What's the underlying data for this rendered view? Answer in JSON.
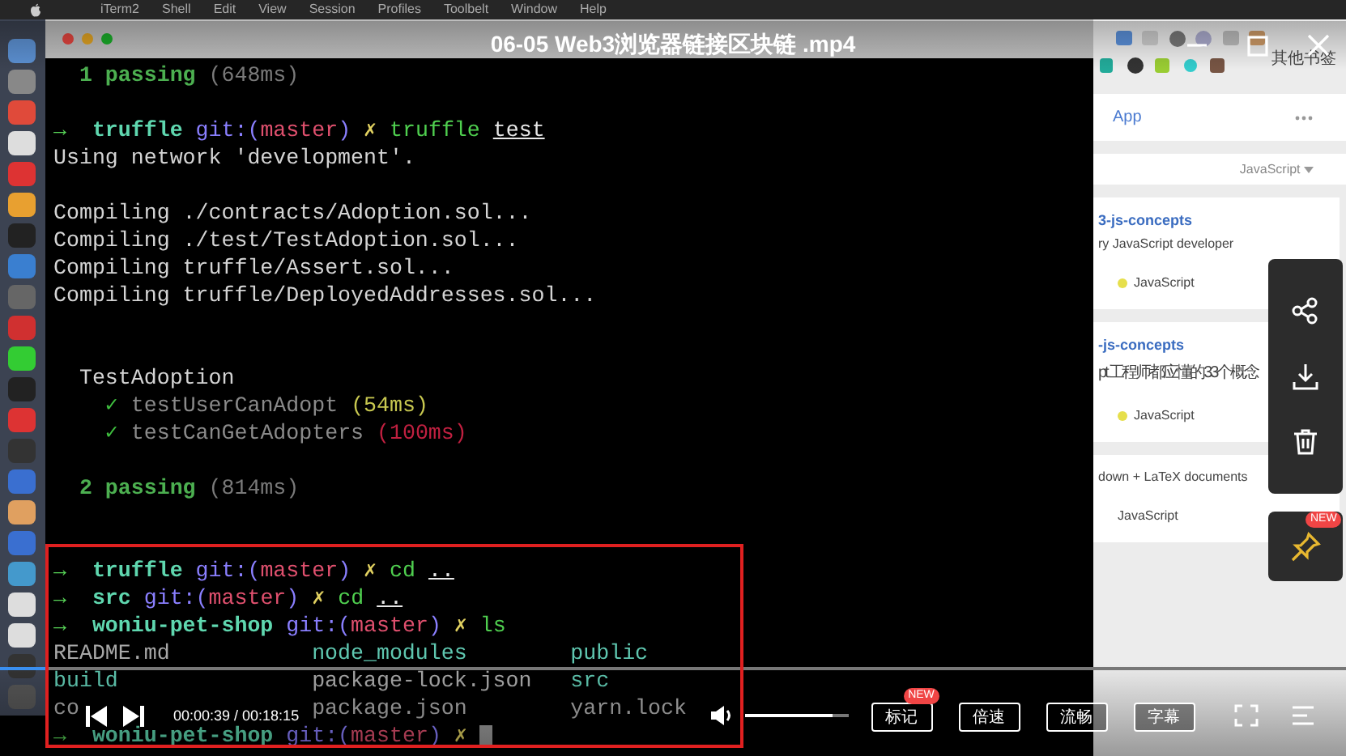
{
  "menubar": {
    "items": [
      "iTerm2",
      "Shell",
      "Edit",
      "View",
      "Session",
      "Profiles",
      "Toolbelt",
      "Window",
      "Help"
    ]
  },
  "terminal": {
    "lines": [
      {
        "kind": "text",
        "segments": [
          {
            "text": "  1 passing",
            "kind": "pass"
          },
          {
            "text": " (648ms)",
            "kind": "dim"
          }
        ]
      },
      {
        "kind": "blank"
      },
      {
        "kind": "text",
        "segments": [
          {
            "text": "→",
            "kind": "arrow"
          },
          {
            "text": "  truffle ",
            "kind": "dir"
          },
          {
            "text": "git:(",
            "kind": "git"
          },
          {
            "text": "master",
            "kind": "branch"
          },
          {
            "text": ")",
            "kind": "git"
          },
          {
            "text": " ✗ ",
            "kind": "dirty"
          },
          {
            "text": "truffle ",
            "kind": "cmd"
          },
          {
            "text": "test",
            "kind": "arg"
          }
        ]
      },
      {
        "kind": "text",
        "segments": [
          {
            "text": "Using network 'development'.",
            "kind": "out"
          }
        ]
      },
      {
        "kind": "blank"
      },
      {
        "kind": "text",
        "segments": [
          {
            "text": "Compiling ./contracts/Adoption.sol...",
            "kind": "out"
          }
        ]
      },
      {
        "kind": "text",
        "segments": [
          {
            "text": "Compiling ./test/TestAdoption.sol...",
            "kind": "out"
          }
        ]
      },
      {
        "kind": "text",
        "segments": [
          {
            "text": "Compiling truffle/Assert.sol...",
            "kind": "out"
          }
        ]
      },
      {
        "kind": "text",
        "segments": [
          {
            "text": "Compiling truffle/DeployedAddresses.sol...",
            "kind": "out"
          }
        ]
      },
      {
        "kind": "blank"
      },
      {
        "kind": "blank"
      },
      {
        "kind": "text",
        "segments": [
          {
            "text": "  TestAdoption",
            "kind": "out"
          }
        ]
      },
      {
        "kind": "text",
        "segments": [
          {
            "text": "    ✓ ",
            "kind": "check"
          },
          {
            "text": "testUserCanAdopt ",
            "kind": "name"
          },
          {
            "text": "(54ms)",
            "kind": "fast"
          }
        ]
      },
      {
        "kind": "text",
        "segments": [
          {
            "text": "    ✓ ",
            "kind": "check"
          },
          {
            "text": "testCanGetAdopters ",
            "kind": "name"
          },
          {
            "text": "(100ms)",
            "kind": "slow"
          }
        ]
      },
      {
        "kind": "blank"
      },
      {
        "kind": "text",
        "segments": [
          {
            "text": "  2 passing",
            "kind": "pass"
          },
          {
            "text": " (814ms)",
            "kind": "dim"
          }
        ]
      },
      {
        "kind": "blank"
      },
      {
        "kind": "blank"
      },
      {
        "kind": "text",
        "segments": [
          {
            "text": "→",
            "kind": "arrow"
          },
          {
            "text": "  truffle ",
            "kind": "dir"
          },
          {
            "text": "git:(",
            "kind": "git"
          },
          {
            "text": "master",
            "kind": "branch"
          },
          {
            "text": ")",
            "kind": "git"
          },
          {
            "text": " ✗ ",
            "kind": "dirty"
          },
          {
            "text": "cd ",
            "kind": "cmd"
          },
          {
            "text": "..",
            "kind": "arg"
          }
        ]
      },
      {
        "kind": "text",
        "segments": [
          {
            "text": "→",
            "kind": "arrow"
          },
          {
            "text": "  src ",
            "kind": "dir"
          },
          {
            "text": "git:(",
            "kind": "git"
          },
          {
            "text": "master",
            "kind": "branch"
          },
          {
            "text": ")",
            "kind": "git"
          },
          {
            "text": " ✗ ",
            "kind": "dirty"
          },
          {
            "text": "cd ",
            "kind": "cmd"
          },
          {
            "text": "..",
            "kind": "arg"
          }
        ]
      },
      {
        "kind": "text",
        "segments": [
          {
            "text": "→",
            "kind": "arrow"
          },
          {
            "text": "  woniu-pet-shop ",
            "kind": "dir"
          },
          {
            "text": "git:(",
            "kind": "git"
          },
          {
            "text": "master",
            "kind": "branch"
          },
          {
            "text": ")",
            "kind": "git"
          },
          {
            "text": " ✗ ",
            "kind": "dirty"
          },
          {
            "text": "ls",
            "kind": "cmd"
          }
        ]
      },
      {
        "kind": "columns",
        "cells": [
          {
            "text": "README.md",
            "kind": "file"
          },
          {
            "text": "node_modules",
            "kind": "folder"
          },
          {
            "text": "public",
            "kind": "folder"
          }
        ]
      },
      {
        "kind": "columns",
        "cells": [
          {
            "text": "build",
            "kind": "folder"
          },
          {
            "text": "package-lock.json",
            "kind": "file"
          },
          {
            "text": "src",
            "kind": "folder"
          }
        ]
      },
      {
        "kind": "columns",
        "cells": [
          {
            "text": "co",
            "kind": "file"
          },
          {
            "text": "package.json",
            "kind": "file"
          },
          {
            "text": "yarn.lock",
            "kind": "file"
          }
        ]
      },
      {
        "kind": "text",
        "cursor": true,
        "segments": [
          {
            "text": "→",
            "kind": "arrow"
          },
          {
            "text": "  woniu-pet-shop ",
            "kind": "dir"
          },
          {
            "text": "git:(",
            "kind": "git"
          },
          {
            "text": "master",
            "kind": "branch"
          },
          {
            "text": ")",
            "kind": "git"
          },
          {
            "text": " ✗ ",
            "kind": "dirty"
          }
        ]
      }
    ]
  },
  "browser": {
    "bookmark_folder": "其他书签",
    "link": "App",
    "filter": "JavaScript",
    "cards": [
      {
        "title": "3-js-concepts",
        "description": "ry JavaScript developer",
        "language": "JavaScript",
        "color": "#e6df4c"
      },
      {
        "title": "-js-concepts",
        "description": "pt 工程师都应懂的33个概念",
        "language": "JavaScript",
        "color": "#e6df4c"
      },
      {
        "description": "down + LaTeX documents",
        "language": "JavaScript"
      }
    ]
  },
  "player": {
    "title": "06-05 Web3浏览器链接区块链 .mp4",
    "time": "00:00:39 / 00:18:15",
    "progress": {
      "level": 0.036
    },
    "volume": {
      "level": 0.85
    },
    "buttons": [
      {
        "label": "标记",
        "badge": "NEW"
      },
      {
        "label": "倍速"
      },
      {
        "label": "流畅"
      },
      {
        "label": "字幕"
      }
    ],
    "side_actions": [
      {
        "kind": "share"
      },
      {
        "kind": "download"
      },
      {
        "kind": "delete"
      }
    ],
    "pin": {
      "badge": "NEW"
    }
  }
}
